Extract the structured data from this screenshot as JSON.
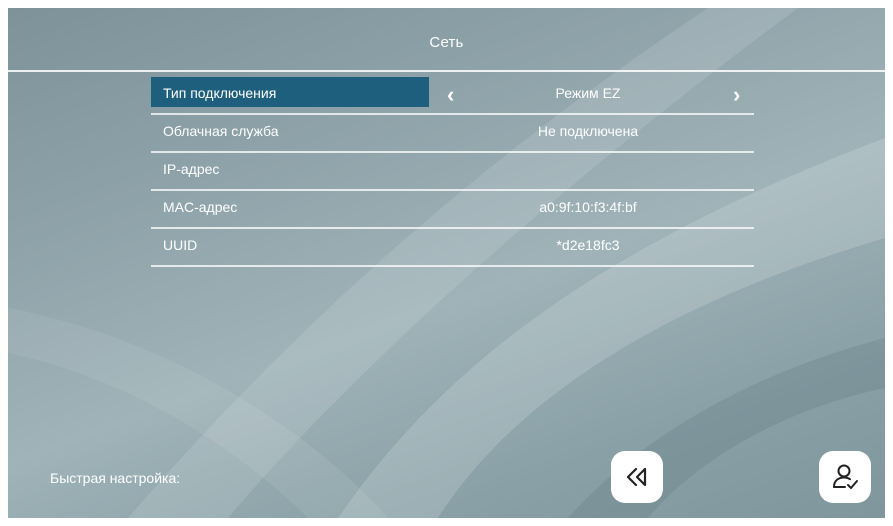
{
  "header": {
    "title": "Сеть"
  },
  "settings": {
    "rows": [
      {
        "label": "Тип подключения",
        "value": "Режим EZ"
      },
      {
        "label": "Облачная служба",
        "value": "Не подключена"
      },
      {
        "label": "IP-адрес",
        "value": ""
      },
      {
        "label": "MAC-адрес",
        "value": "a0:9f:10:f3:4f:bf"
      },
      {
        "label": "UUID",
        "value": "*d2e18fc3"
      }
    ]
  },
  "footer": {
    "quick_setup_label": "Быстрая настройка:"
  },
  "icons": {
    "prev": "chevron-left-icon",
    "next": "chevron-right-icon",
    "back": "rewind-back-icon",
    "user": "user-check-icon"
  },
  "colors": {
    "selected_bg": "#1f5f7e",
    "text": "#ffffff"
  }
}
